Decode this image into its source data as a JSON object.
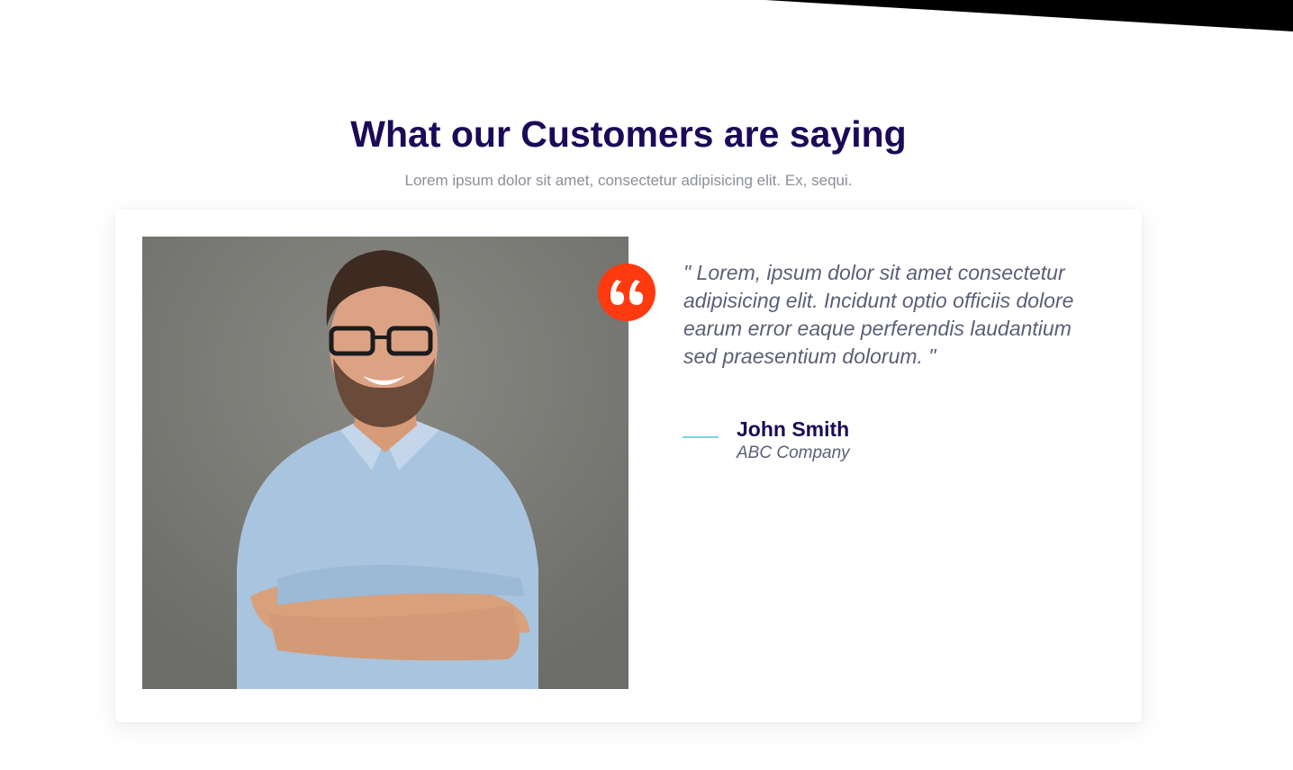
{
  "section": {
    "title": "What our Customers are saying",
    "subtitle": "Lorem ipsum dolor sit amet, consectetur adipisicing elit. Ex, sequi."
  },
  "testimonial": {
    "quote": "\" Lorem, ipsum dolor sit amet consectetur adipisicing elit. Incidunt optio officiis dolore earum error eaque perferendis laudantium sed praesentium dolorum. \"",
    "author_name": "John Smith",
    "author_company": "ABC Company",
    "quote_icon": "quote-icon",
    "photo": "customer-photo"
  },
  "colors": {
    "heading": "#1b0a57",
    "accent": "#ff3a0e",
    "divider": "#7ed2ea",
    "body_text": "#5c5f76"
  }
}
